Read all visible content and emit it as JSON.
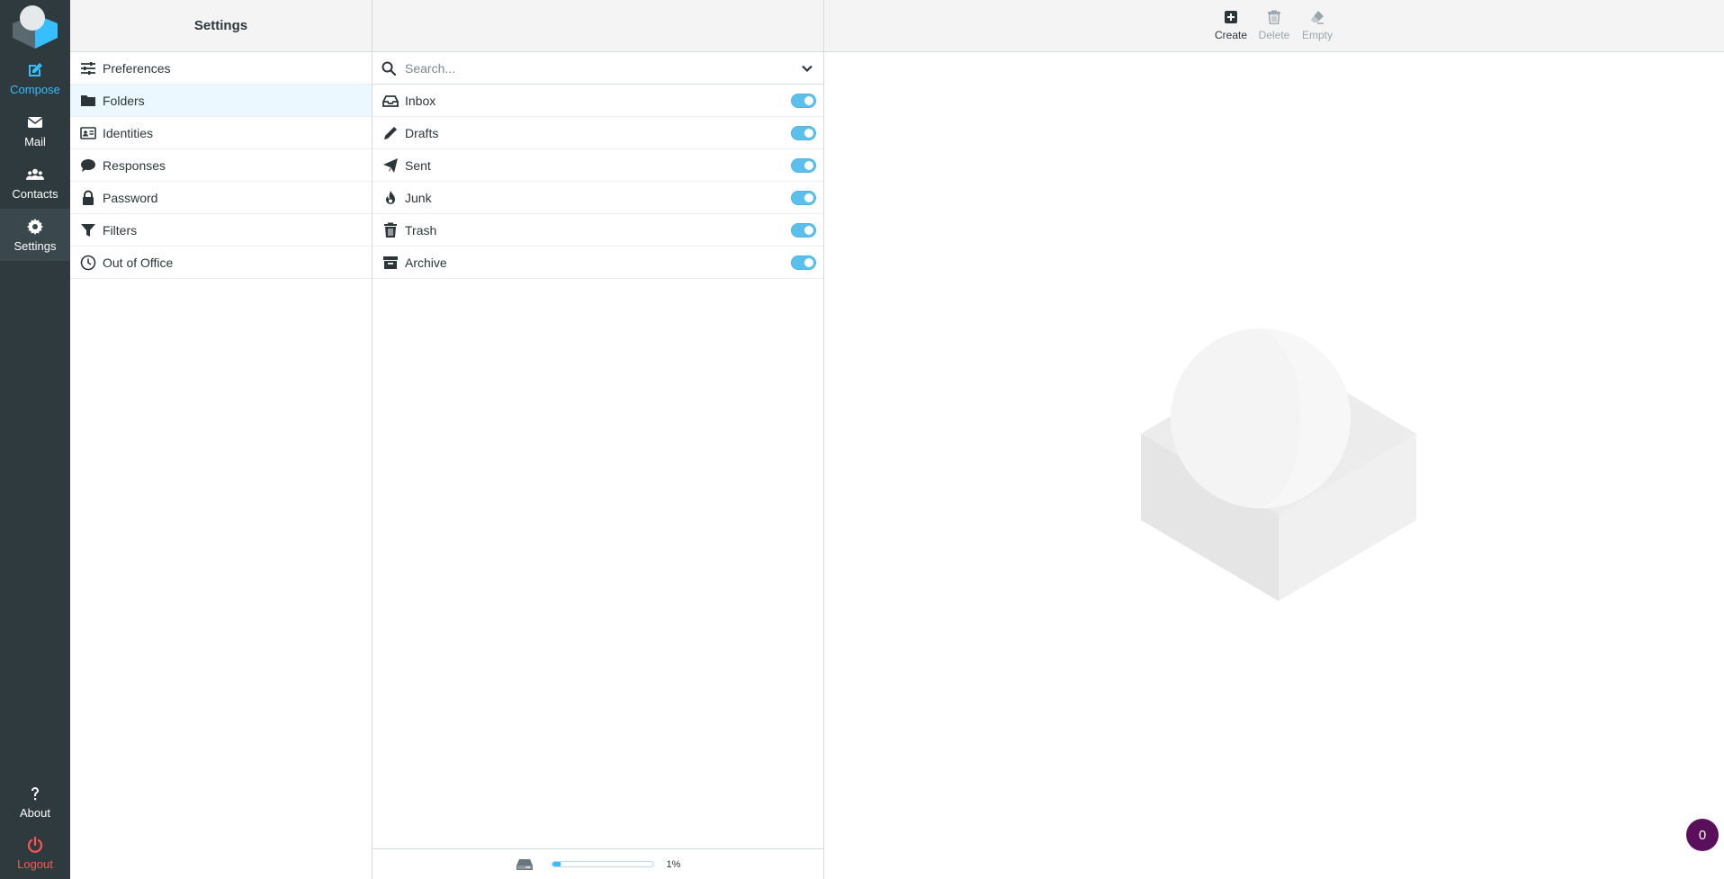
{
  "rail": {
    "compose": "Compose",
    "mail": "Mail",
    "contacts": "Contacts",
    "settings": "Settings",
    "about": "About",
    "logout": "Logout"
  },
  "settings": {
    "title": "Settings",
    "items": [
      {
        "label": "Preferences",
        "icon": "sliders-icon"
      },
      {
        "label": "Folders",
        "icon": "folder-icon"
      },
      {
        "label": "Identities",
        "icon": "id-card-icon"
      },
      {
        "label": "Responses",
        "icon": "comment-icon"
      },
      {
        "label": "Password",
        "icon": "lock-icon"
      },
      {
        "label": "Filters",
        "icon": "filter-icon"
      },
      {
        "label": "Out of Office",
        "icon": "clock-icon"
      }
    ],
    "selected": "Folders"
  },
  "folders": {
    "search_placeholder": "Search...",
    "items": [
      {
        "label": "Inbox",
        "icon": "inbox-icon",
        "subscribed": true
      },
      {
        "label": "Drafts",
        "icon": "pencil-icon",
        "subscribed": true
      },
      {
        "label": "Sent",
        "icon": "paper-plane-icon",
        "subscribed": true
      },
      {
        "label": "Junk",
        "icon": "fire-icon",
        "subscribed": true
      },
      {
        "label": "Trash",
        "icon": "trash-icon",
        "subscribed": true
      },
      {
        "label": "Archive",
        "icon": "archive-icon",
        "subscribed": true
      }
    ],
    "quota_percent": 1,
    "quota_label": "1%"
  },
  "toolbar": {
    "create": "Create",
    "delete": "Delete",
    "empty": "Empty"
  },
  "badge": "0",
  "colors": {
    "rail_bg": "#2f3a3f",
    "accent": "#37beff",
    "logout": "#ff5552",
    "badge": "#5a0f5a"
  }
}
